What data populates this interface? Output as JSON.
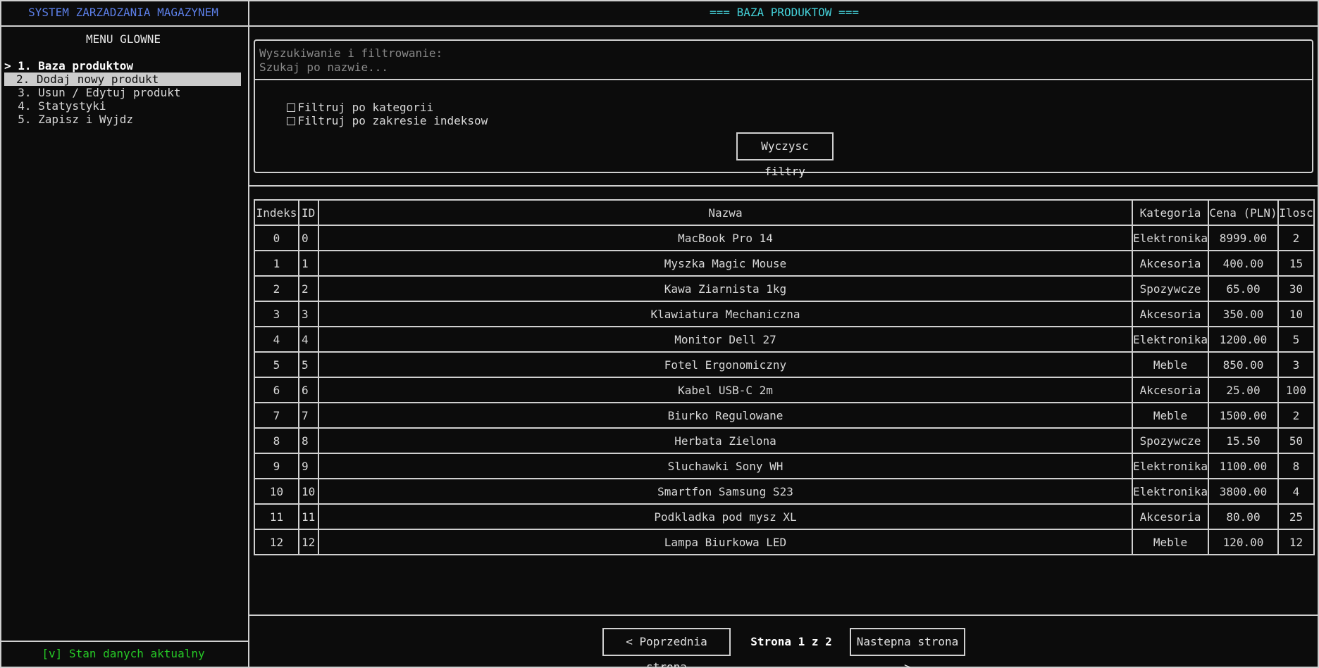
{
  "sidebar": {
    "app_title": "SYSTEM ZARZADZANIA MAGAZYNEM",
    "menu_title": "MENU GLOWNE",
    "items": [
      {
        "label": "> 1. Baza produktow"
      },
      {
        "label": "2. Dodaj nowy produkt"
      },
      {
        "label": "  3. Usun / Edytuj produkt"
      },
      {
        "label": "  4. Statystyki"
      },
      {
        "label": "  5. Zapisz i Wyjdz"
      }
    ],
    "status": "[v] Stan danych aktualny"
  },
  "main": {
    "title": "=== BAZA PRODUKTOW ===",
    "filters": {
      "label": "Wyszukiwanie i filtrowanie:",
      "search_placeholder": "Szukaj po nazwie...",
      "search_value": "",
      "category_filter": "Filtruj po kategorii",
      "index_filter": "Filtruj po zakresie indeksow",
      "clear_button": "Wyczysc filtry"
    },
    "table": {
      "headers": [
        "Indeks",
        "ID",
        "Nazwa",
        "Kategoria",
        "Cena (PLN)",
        "Ilosc"
      ],
      "rows": [
        [
          "0",
          "0",
          "MacBook Pro 14",
          "Elektronika",
          "8999.00",
          "2"
        ],
        [
          "1",
          "1",
          "Myszka Magic Mouse",
          "Akcesoria",
          "400.00",
          "15"
        ],
        [
          "2",
          "2",
          "Kawa Ziarnista 1kg",
          "Spozywcze",
          "65.00",
          "30"
        ],
        [
          "3",
          "3",
          "Klawiatura Mechaniczna",
          "Akcesoria",
          "350.00",
          "10"
        ],
        [
          "4",
          "4",
          "Monitor Dell 27",
          "Elektronika",
          "1200.00",
          "5"
        ],
        [
          "5",
          "5",
          "Fotel Ergonomiczny",
          "Meble",
          "850.00",
          "3"
        ],
        [
          "6",
          "6",
          "Kabel USB-C 2m",
          "Akcesoria",
          "25.00",
          "100"
        ],
        [
          "7",
          "7",
          "Biurko Regulowane",
          "Meble",
          "1500.00",
          "2"
        ],
        [
          "8",
          "8",
          "Herbata Zielona",
          "Spozywcze",
          "15.50",
          "50"
        ],
        [
          "9",
          "9",
          "Sluchawki Sony WH",
          "Elektronika",
          "1100.00",
          "8"
        ],
        [
          "10",
          "10",
          "Smartfon Samsung S23",
          "Elektronika",
          "3800.00",
          "4"
        ],
        [
          "11",
          "11",
          "Podkladka pod mysz XL",
          "Akcesoria",
          "80.00",
          "25"
        ],
        [
          "12",
          "12",
          "Lampa Biurkowa LED",
          "Meble",
          "120.00",
          "12"
        ]
      ]
    },
    "pagination": {
      "prev": "< Poprzednia strona",
      "info": "Strona 1 z 2",
      "next": "Nastepna strona >"
    }
  },
  "colors": {
    "background": "#0c0c0c",
    "app_title": "#5c7fe8",
    "main_title": "#44d0d8",
    "status": "#26c926",
    "hover_row": "#cccccc"
  }
}
